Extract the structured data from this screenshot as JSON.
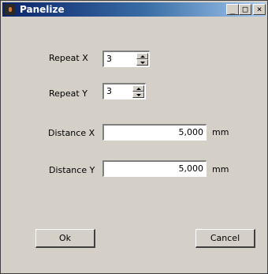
{
  "window": {
    "title": "Panelize"
  },
  "caption_buttons": {
    "minimize": "_",
    "maximize": "□",
    "close": "×"
  },
  "fields": {
    "repeat_x": {
      "label": "Repeat X",
      "value": "3"
    },
    "repeat_y": {
      "label": "Repeat Y",
      "value": "3"
    },
    "distance_x": {
      "label": "Distance X",
      "value": "5,000",
      "unit": "mm"
    },
    "distance_y": {
      "label": "Distance Y",
      "value": "5,000",
      "unit": "mm"
    }
  },
  "buttons": {
    "ok": "Ok",
    "cancel": "Cancel"
  }
}
